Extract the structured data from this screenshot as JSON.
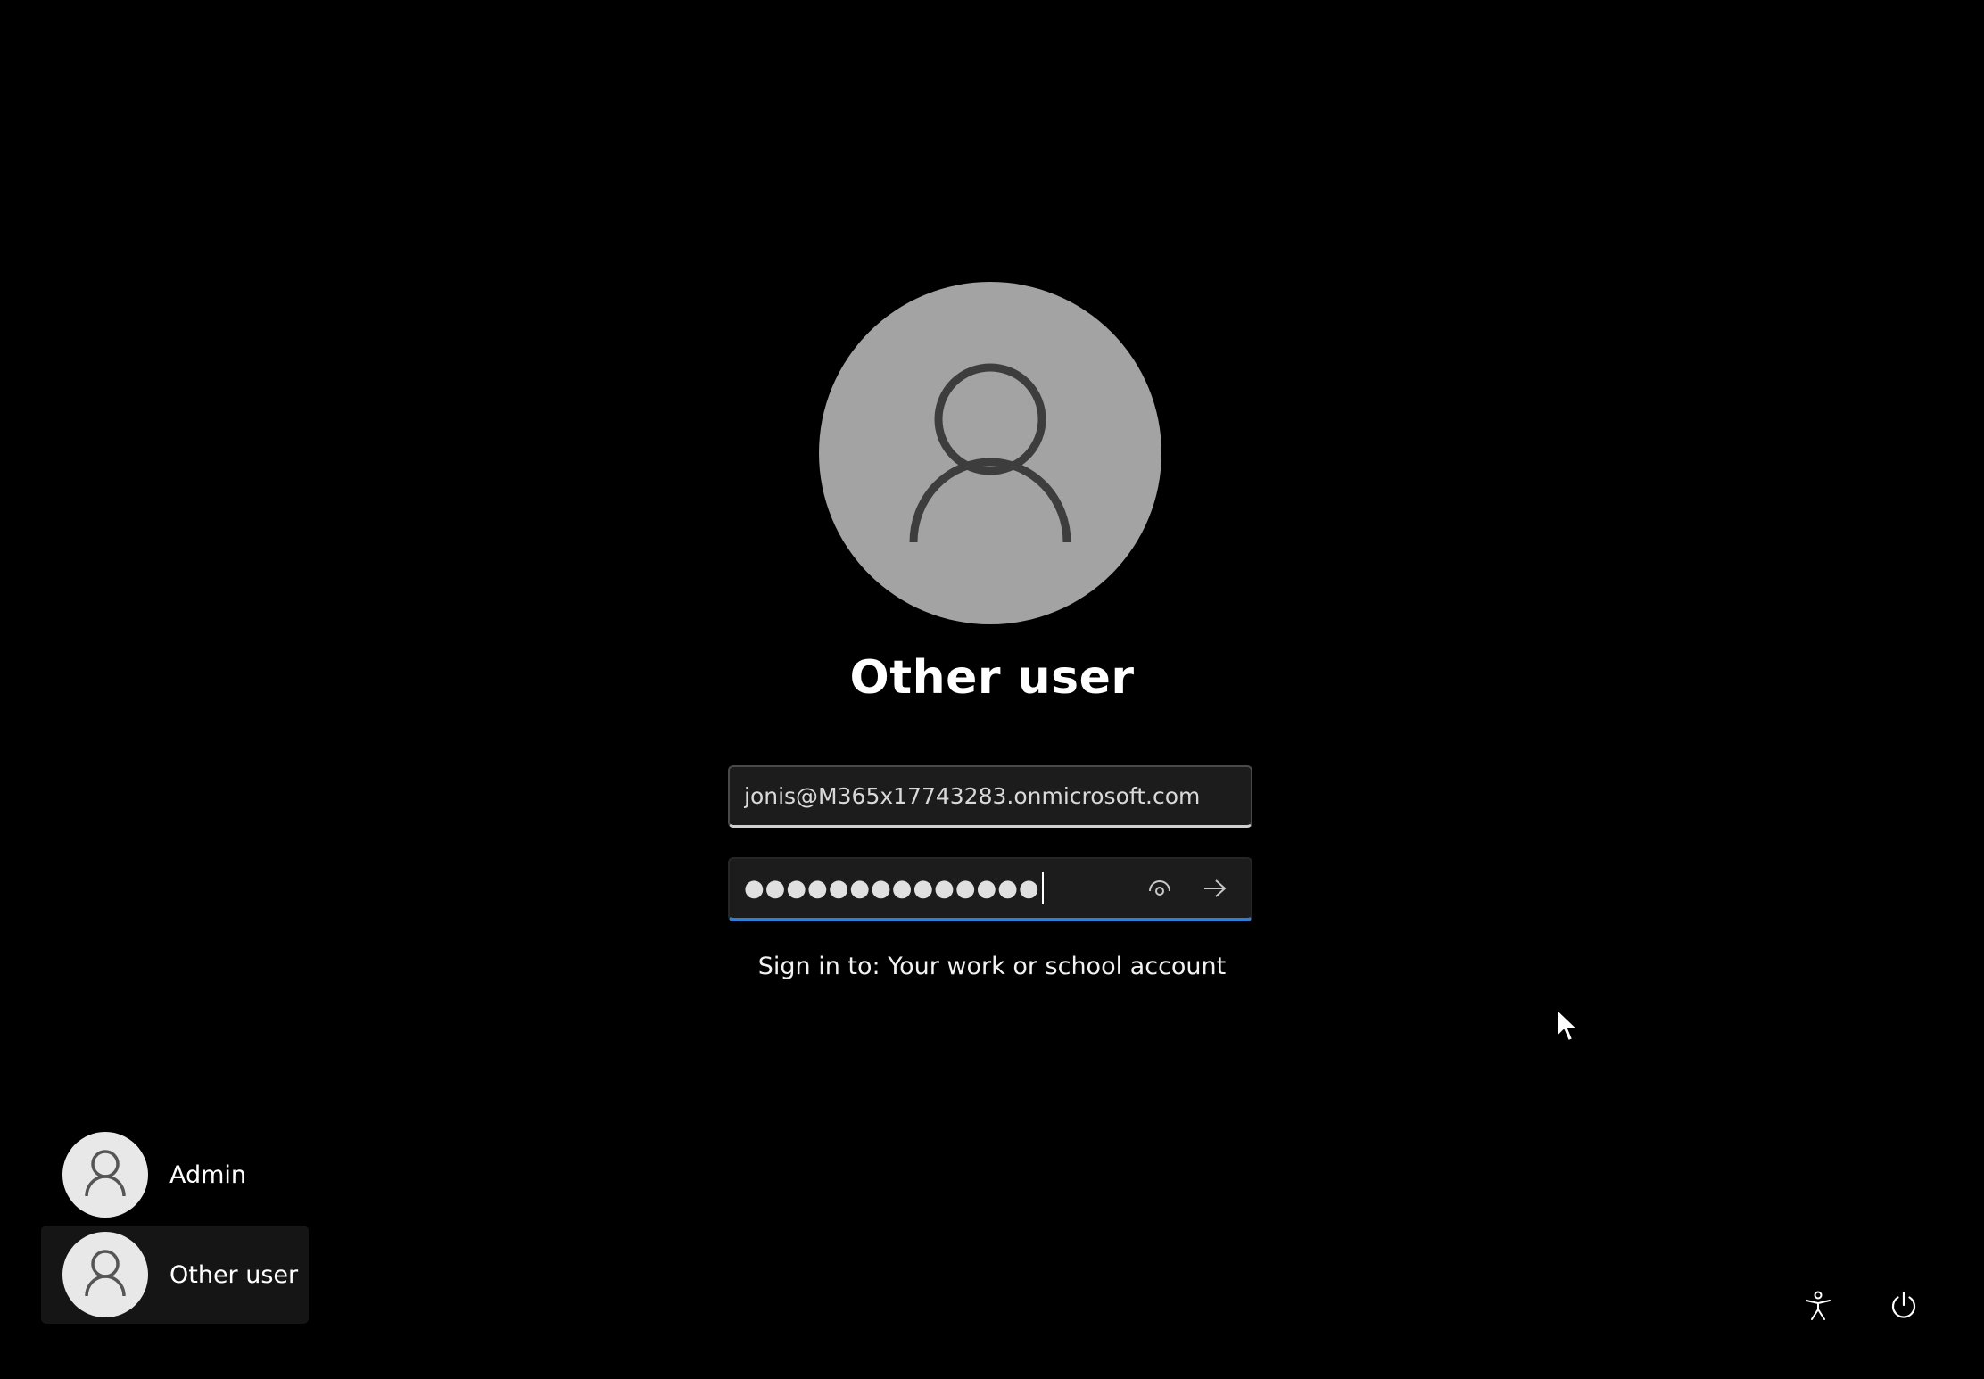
{
  "selected_user": {
    "display_name": "Other user",
    "username_value": "jonis@M365x17743283.onmicrosoft.com",
    "password_masked": "●●●●●●●●●●●●●●",
    "signin_target": "Sign in to: Your work or school account"
  },
  "icons": {
    "avatar": "person-icon",
    "reveal": "eye-icon",
    "submit": "arrow-right-icon",
    "accessibility": "accessibility-icon",
    "power": "power-icon"
  },
  "user_list": [
    {
      "label": "Admin",
      "selected": false
    },
    {
      "label": "Other user",
      "selected": true
    }
  ],
  "colors": {
    "background": "#000000",
    "accent": "#2f7fd6",
    "avatar_bg": "#a3a3a3"
  }
}
